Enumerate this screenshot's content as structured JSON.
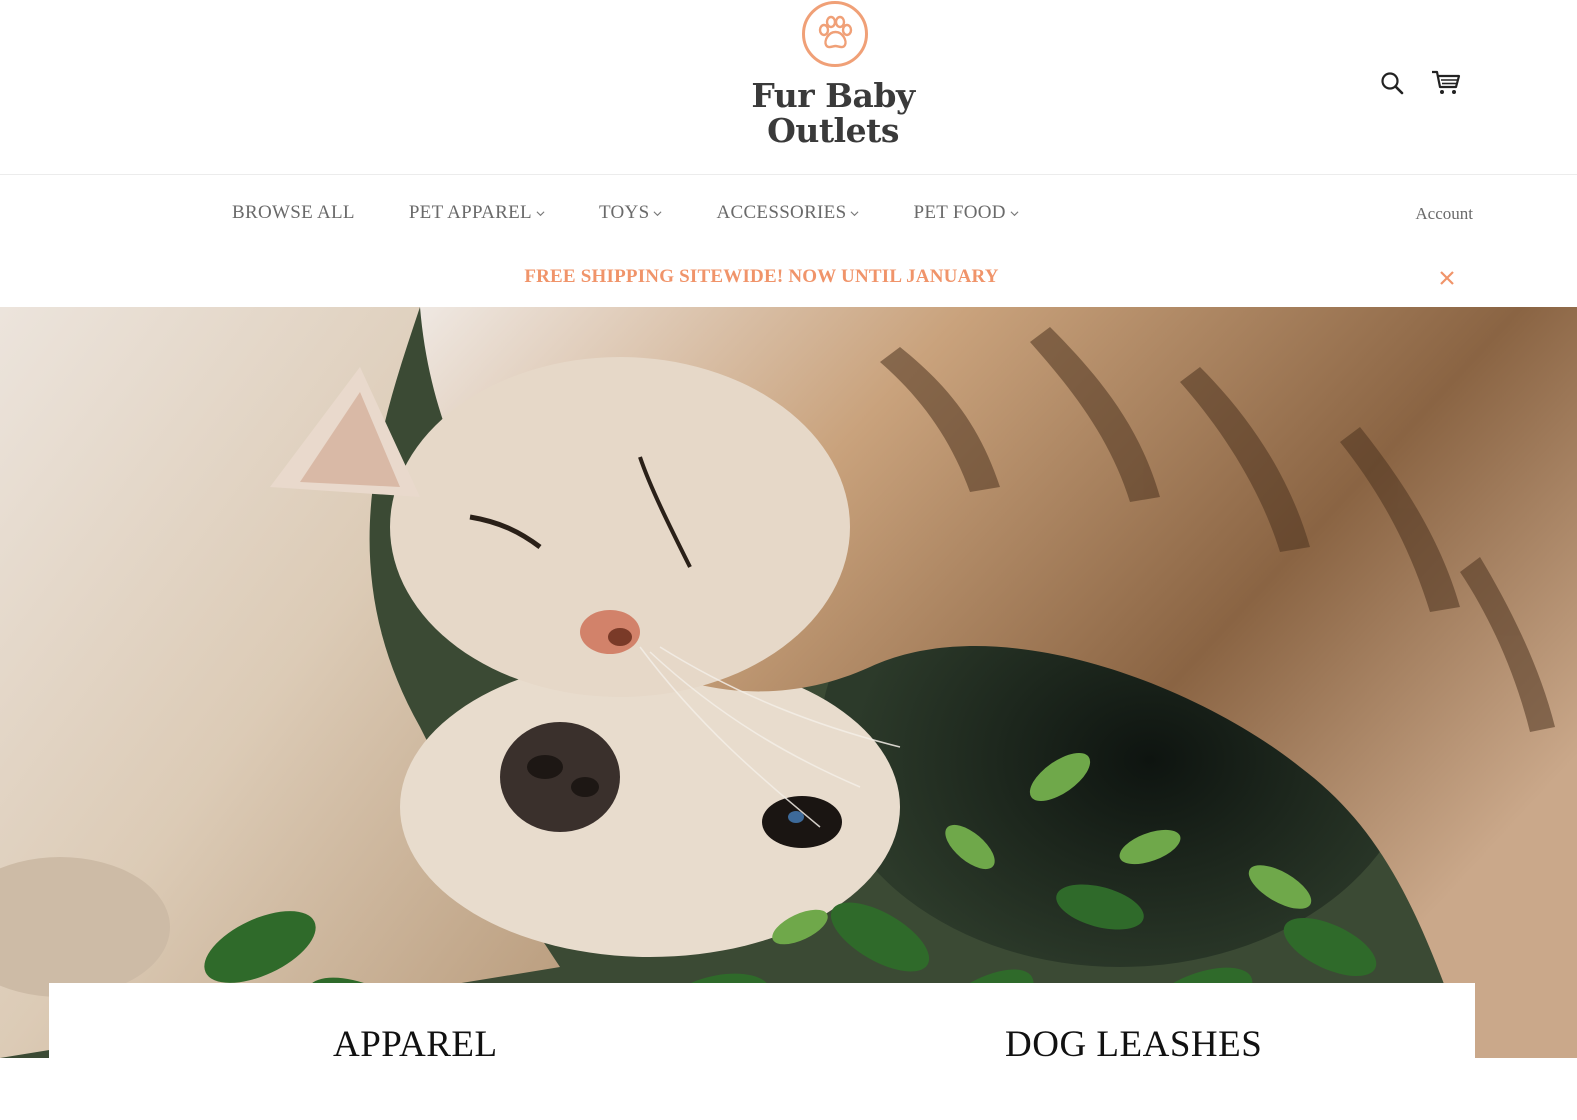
{
  "brand": {
    "name_line1": "Fur Baby",
    "name_line2": "Outlets",
    "accent_color": "#f0946a",
    "logo_icon": "paw-icon"
  },
  "header": {
    "search_icon": "search-icon",
    "cart_icon": "cart-icon"
  },
  "nav": {
    "items": [
      {
        "label": "BROWSE ALL",
        "has_dropdown": false
      },
      {
        "label": "PET APPAREL",
        "has_dropdown": true
      },
      {
        "label": "TOYS",
        "has_dropdown": true
      },
      {
        "label": "ACCESSORIES",
        "has_dropdown": true
      },
      {
        "label": "PET FOOD",
        "has_dropdown": true
      }
    ],
    "account_label": "Account"
  },
  "announcement": {
    "text": "FREE SHIPPING SITEWIDE! NOW UNTIL JANUARY",
    "close_icon": "close-icon"
  },
  "collections": [
    {
      "label": "APPAREL"
    },
    {
      "label": "DOG LEASHES"
    }
  ]
}
